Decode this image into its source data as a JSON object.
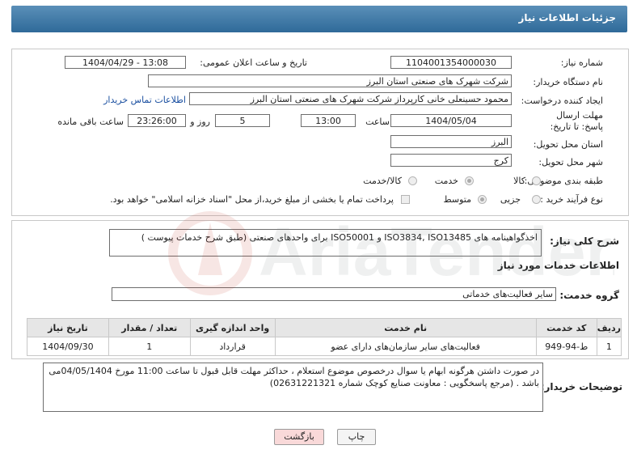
{
  "header": {
    "title": "جزئیات اطلاعات نیاز"
  },
  "fields": {
    "need_number_label": "شماره نیاز:",
    "need_number": "1104001354000030",
    "announce_datetime_label": "تاریخ و ساعت اعلان عمومی:",
    "announce_datetime": "1404/04/29 - 13:08",
    "buyer_org_label": "نام دستگاه خریدار:",
    "buyer_org": "شرکت شهرک های صنعتی استان البرز",
    "requester_label": "ایجاد کننده درخواست:",
    "requester": "محمود حسینعلی خانی کارپرداز شرکت شهرک های صنعتی استان البرز",
    "buyer_contact_link": "اطلاعات تماس خریدار",
    "deadline_label": "مهلت ارسال پاسخ: تا تاریخ:",
    "deadline_date": "1404/05/04",
    "time_label": "ساعت",
    "deadline_time": "13:00",
    "days_value": "5",
    "days_label": "روز و",
    "remaining_time": "23:26:00",
    "remaining_label": "ساعت باقی مانده",
    "province_label": "استان محل تحویل:",
    "province": "البرز",
    "city_label": "شهر محل تحویل:",
    "city": "کرج",
    "category_label": "طبقه بندی موضوعی:",
    "category_options": [
      "کالا",
      "خدمت",
      "کالا/خدمت"
    ],
    "process_label": "نوع فرآیند خرید :",
    "process_options": [
      "جزیی",
      "متوسط"
    ],
    "payment_note": "پرداخت تمام یا بخشی از مبلغ خرید،از محل \"اسناد خزانه اسلامی\" خواهد بود."
  },
  "summary": {
    "label": "شرح کلی نیاز:",
    "text": "اخذگواهینامه های ISO3834, ISO13485 و ISO50001 برای واحدهای صنعتی (طبق شرح خدمات پیوست )"
  },
  "services": {
    "section_title": "اطلاعات خدمات مورد نیاز",
    "group_label": "گروه خدمت:",
    "group_value": "سایر فعالیت‌های خدماتی",
    "columns": [
      "ردیف",
      "کد خدمت",
      "نام خدمت",
      "واحد اندازه گیری",
      "تعداد / مقدار",
      "تاریخ نیاز"
    ],
    "rows": [
      {
        "row": "1",
        "code": "ط-94-949",
        "name": "فعالیت‌های سایر سازمان‌های دارای عضو",
        "unit": "قرارداد",
        "qty": "1",
        "date": "1404/09/30"
      }
    ]
  },
  "notes": {
    "label": "توضیحات خریدار:",
    "text": "در صورت داشتن هرگونه ابهام یا سوال درخصوص موضوع استعلام ، حداکثر مهلت قابل قبول تا ساعت 11:00 مورخ 04/05/1404می باشد . (مرجع پاسخگویی : معاونت صنایع کوچک شماره 02631221321)"
  },
  "buttons": {
    "print": "چاپ",
    "back": "بازگشت"
  },
  "watermark": {
    "text": "AriaTender.neT"
  }
}
